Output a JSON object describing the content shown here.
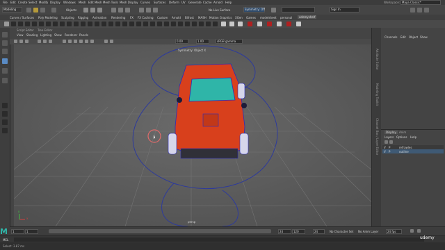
{
  "menubar": {
    "items": [
      "File",
      "Edit",
      "Create",
      "Select",
      "Modify",
      "Display",
      "Windows",
      "Mesh",
      "Edit Mesh",
      "Mesh Tools",
      "Mesh Display",
      "Curves",
      "Surfaces",
      "Deform",
      "UV",
      "Generate",
      "Cache",
      "Arnold",
      "Help"
    ],
    "workspace_label": "Workspace:",
    "workspace_value": "Maya Classic*"
  },
  "statusline": {
    "mode": "Modeling",
    "objects_label": "Objects",
    "live_surface": "No Live Surface",
    "symmetry": "Symmetry: Off",
    "sign_in": "Sign In"
  },
  "shelf_tabs": [
    "Curves / Surfaces",
    "Poly Modeling",
    "Sculpting",
    "Rigging",
    "Animation",
    "Rendering",
    "FX",
    "FX Caching",
    "Custom",
    "Arnold",
    "Bifrost",
    "MASH",
    "Motion Graphics",
    "XGen",
    "Games",
    "modelsheet",
    "personal",
    "udemyshelf"
  ],
  "panel": {
    "tabs": [
      "Script Editor",
      "Tree Editor"
    ],
    "menus": [
      "View",
      "Shading",
      "Lighting",
      "Show",
      "Renderer",
      "Panels"
    ],
    "field1": "0.00",
    "field2": "1.00",
    "colorspace": "sRGB gamma"
  },
  "viewport": {
    "hud_top": "Symmetry: Object X",
    "camera_label": "persp",
    "axis_x": "x",
    "axis_y": "y",
    "colors": {
      "body": "#d8401c",
      "glass": "#2fb5a8",
      "wire": "#2b2bb8",
      "grid": "#777777",
      "curve": "#2d3a9c"
    }
  },
  "channelbox": {
    "menus": [
      "Channels",
      "Edit",
      "Object",
      "Show"
    ]
  },
  "layers": {
    "tabs": [
      "Display",
      "Anim"
    ],
    "menus": [
      "Layers",
      "Options",
      "Help"
    ],
    "rows": [
      {
        "v": "V",
        "p": "P",
        "name": "refrawles"
      },
      {
        "v": "V",
        "p": "P",
        "name": "outline"
      }
    ]
  },
  "sidetabs": [
    "Attribute Editor",
    "Modeling Toolkit",
    "Channel Box / Layer Editor"
  ],
  "range": {
    "start": "1",
    "anim_start": "1",
    "anim_end": "120",
    "end": "24",
    "current": "24",
    "character_set": "No Character Set",
    "anim_layer": "No Anim Layer",
    "fps": "24 fps"
  },
  "cmd": {
    "lang": "MEL"
  },
  "help": {
    "text": "Select: 3.87 ms"
  },
  "brand": {
    "logo": "M",
    "watermark": "udemy"
  }
}
